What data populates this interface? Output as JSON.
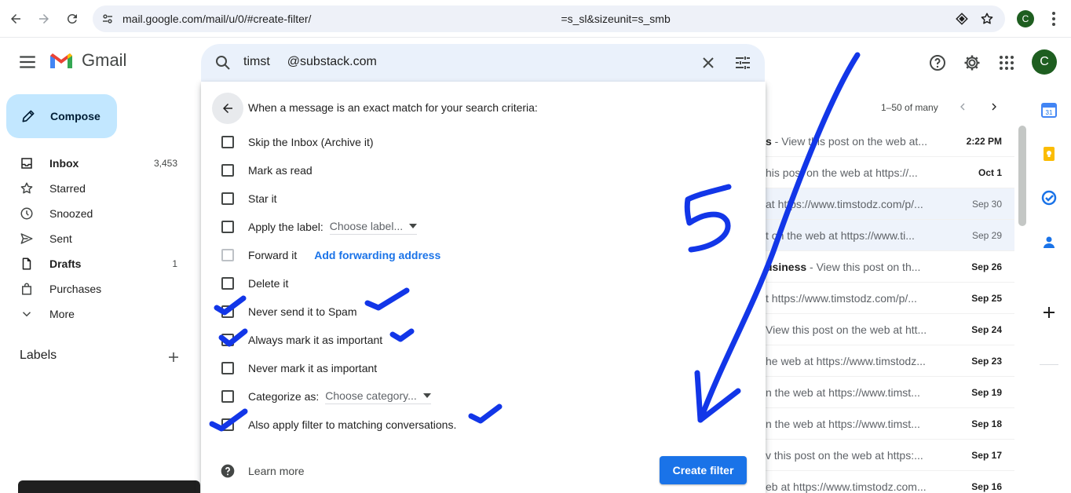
{
  "browser": {
    "url_start": "mail.google.com/mail/u/0/#create-filter/",
    "url_end": "=s_sl&sizeunit=s_smb",
    "profile_initial": "C"
  },
  "gmail": {
    "app_name": "Gmail",
    "search_value_start": "timst",
    "search_value_end": "@substack.com",
    "avatar_initial": "C"
  },
  "sidebar": {
    "compose_label": "Compose",
    "items": [
      {
        "label": "Inbox",
        "count": "3,453",
        "icon": "inbox-icon"
      },
      {
        "label": "Starred",
        "count": "",
        "icon": "star-icon"
      },
      {
        "label": "Snoozed",
        "count": "",
        "icon": "clock-icon"
      },
      {
        "label": "Sent",
        "count": "",
        "icon": "send-icon"
      },
      {
        "label": "Drafts",
        "count": "1",
        "icon": "draft-icon"
      },
      {
        "label": "Purchases",
        "count": "",
        "icon": "purchases-icon"
      },
      {
        "label": "More",
        "count": "",
        "icon": "chevron-down-icon"
      }
    ],
    "labels_heading": "Labels"
  },
  "filter_dialog": {
    "heading": "When a message is an exact match for your search criteria:",
    "options": [
      {
        "label": "Skip the Inbox (Archive it)"
      },
      {
        "label": "Mark as read"
      },
      {
        "label": "Star it"
      },
      {
        "label": "Apply the label:",
        "dropdown": "Choose label..."
      },
      {
        "label": "Forward it",
        "link": "Add forwarding address"
      },
      {
        "label": "Delete it"
      },
      {
        "label": "Never send it to Spam"
      },
      {
        "label": "Always mark it as important"
      },
      {
        "label": "Never mark it as important"
      },
      {
        "label": "Categorize as:",
        "dropdown": "Choose category..."
      },
      {
        "label": "Also apply filter to matching conversations."
      }
    ],
    "learn_more": "Learn more",
    "create_button": "Create filter"
  },
  "mail_list": {
    "pager": "1–50 of many",
    "rows": [
      {
        "snippet_bold": "s",
        "snippet": " - View this post on the web at...",
        "date": "2:22 PM",
        "bold": true,
        "selected": false
      },
      {
        "snippet_bold": "",
        "snippet": "his post on the web at https://...",
        "date": "Oct 1",
        "bold": true,
        "selected": false
      },
      {
        "snippet_bold": "",
        "snippet": "at https://www.timstodz.com/p/...",
        "date": "Sep 30",
        "bold": false,
        "selected": true
      },
      {
        "snippet_bold": "",
        "snippet": "t on the web at https://www.ti...",
        "date": "Sep 29",
        "bold": false,
        "selected": true
      },
      {
        "snippet_bold": "usiness",
        "snippet": " - View this post on th...",
        "date": "Sep 26",
        "bold": true,
        "selected": false
      },
      {
        "snippet_bold": "",
        "snippet": "t https://www.timstodz.com/p/...",
        "date": "Sep 25",
        "bold": true,
        "selected": false
      },
      {
        "snippet_bold": "",
        "snippet": "View this post on the web at htt...",
        "date": "Sep 24",
        "bold": true,
        "selected": false
      },
      {
        "snippet_bold": "",
        "snippet": "he web at https://www.timstodz...",
        "date": "Sep 23",
        "bold": true,
        "selected": false
      },
      {
        "snippet_bold": "",
        "snippet": "n the web at https://www.timst...",
        "date": "Sep 19",
        "bold": true,
        "selected": false
      },
      {
        "snippet_bold": "",
        "snippet": "n the web at https://www.timst...",
        "date": "Sep 18",
        "bold": true,
        "selected": false
      },
      {
        "snippet_bold": "",
        "snippet": "v this post on the web at https:...",
        "date": "Sep 17",
        "bold": true,
        "selected": false
      },
      {
        "snippet_bold": "",
        "snippet": "eb at https://www.timstodz.com...",
        "date": "Sep 16",
        "bold": true,
        "selected": false
      }
    ]
  },
  "annotation": {
    "number": "5",
    "color": "#1236e8"
  },
  "colors": {
    "accent": "#1a73e8",
    "compose_bg": "#c2e7ff",
    "search_bg": "#eaf1fb",
    "avatar": "#1e5e20"
  }
}
